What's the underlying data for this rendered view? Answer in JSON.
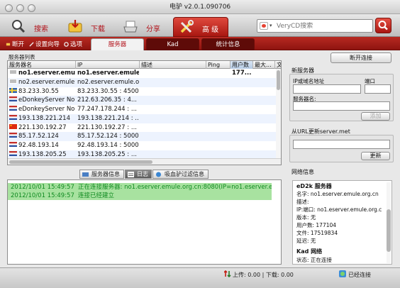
{
  "window": {
    "title": "电驴 v2.0.1.090706"
  },
  "toolbar": {
    "buttons": [
      {
        "label": "搜索",
        "icon": "magnifier-icon"
      },
      {
        "label": "下载",
        "icon": "download-box-icon"
      },
      {
        "label": "分享",
        "icon": "share-tray-icon"
      },
      {
        "label": "高 级",
        "icon": "tools-icon",
        "active": true
      }
    ],
    "search": {
      "placeholder": "VeryCD搜索",
      "engine_icon": "verycd-icon"
    },
    "search_button_icon": "search-icon"
  },
  "subbar": {
    "disconnect": "断开",
    "wizard": "设置向导",
    "options": "选项",
    "tabs": [
      {
        "label": "服务器",
        "active": true
      },
      {
        "label": "Kad",
        "active": false
      },
      {
        "label": "统计信息",
        "active": false
      }
    ]
  },
  "server_list": {
    "title": "服务器列表",
    "columns": [
      "服务器名",
      "IP",
      "描述",
      "Ping",
      "用户数",
      "最大...",
      "文"
    ],
    "rows": [
      {
        "name": "no1.eserver.emule...",
        "ip": "no1.eserver.emule.org...",
        "desc": "",
        "ping": "",
        "users": "177...",
        "bold": true,
        "flag": "server"
      },
      {
        "name": "no2.eserver.emule...",
        "ip": "no2.eserver.emule.org...",
        "desc": "",
        "ping": "",
        "users": "",
        "bold": false,
        "flag": "server"
      },
      {
        "name": "83.233.30.55",
        "ip": "83.233.30.55 : 4500",
        "desc": "",
        "ping": "",
        "users": "",
        "bold": false,
        "flag": "se"
      },
      {
        "name": "eDonkeyServer No2",
        "ip": "212.63.206.35 : 4...",
        "desc": "",
        "ping": "",
        "users": "",
        "bold": false,
        "flag": "nl"
      },
      {
        "name": "eDonkeyServer No1",
        "ip": "77.247.178.244 : ...",
        "desc": "",
        "ping": "",
        "users": "",
        "bold": false,
        "flag": "nl"
      },
      {
        "name": "193.138.221.214",
        "ip": "193.138.221.214 : ...",
        "desc": "",
        "ping": "",
        "users": "",
        "bold": false,
        "flag": "nl"
      },
      {
        "name": "221.130.192.27",
        "ip": "221.130.192.27 : ...",
        "desc": "",
        "ping": "",
        "users": "",
        "bold": false,
        "flag": "cn"
      },
      {
        "name": "85.17.52.124",
        "ip": "85.17.52.124 : 5000",
        "desc": "",
        "ping": "",
        "users": "",
        "bold": false,
        "flag": "nl"
      },
      {
        "name": "92.48.193.14",
        "ip": "92.48.193.14 : 5000",
        "desc": "",
        "ping": "",
        "users": "",
        "bold": false,
        "flag": "nl"
      },
      {
        "name": "193.138.205.25",
        "ip": "193.138.205.25 : ...",
        "desc": "",
        "ping": "",
        "users": "",
        "bold": false,
        "flag": "nl"
      }
    ]
  },
  "bottom_tabs": [
    {
      "label": "服务器信息",
      "icon": "info-icon",
      "active": false
    },
    {
      "label": "日志",
      "icon": "log-icon",
      "active": true
    },
    {
      "label": "吸血驴过滤信息",
      "icon": "filter-icon",
      "active": false
    }
  ],
  "log": [
    {
      "time": "2012/10/01 15:49:57",
      "message": "正在连接服务器: no1.eserver.emule.org.cn:8080(IP=no1.eserver.emule..."
    },
    {
      "time": "2012/10/01 15:49:57",
      "message": "连接已经建立"
    }
  ],
  "right_panel": {
    "disconnect_button": "断开连接",
    "new_server": {
      "title": "新服务器",
      "ip_label": "IP或域名地址",
      "port_label": "端口",
      "name_label": "服务器名:",
      "add_button": "添加"
    },
    "url_update": {
      "title": "从URL更新server.met",
      "update_button": "更新"
    },
    "network": {
      "title": "网络信息",
      "ed2k_header": "eD2k 服务器",
      "lines": [
        "名字: no1.eserver.emule.org.cn",
        "描述:",
        "IP:端口:      no1.eserver.emule.org.c",
        "版本: 无",
        "用户数:     177104",
        "文件: 17519834",
        "延迟: 无"
      ],
      "kad_header": "Kad 网络",
      "kad_status": "状态:   正在连接"
    }
  },
  "status_bar": {
    "transfer": "上传: 0.00 | 下载: 0.00",
    "connection": "已经连接",
    "transfer_icon": "arrows-icon",
    "connection_icon": "globe-icon"
  }
}
